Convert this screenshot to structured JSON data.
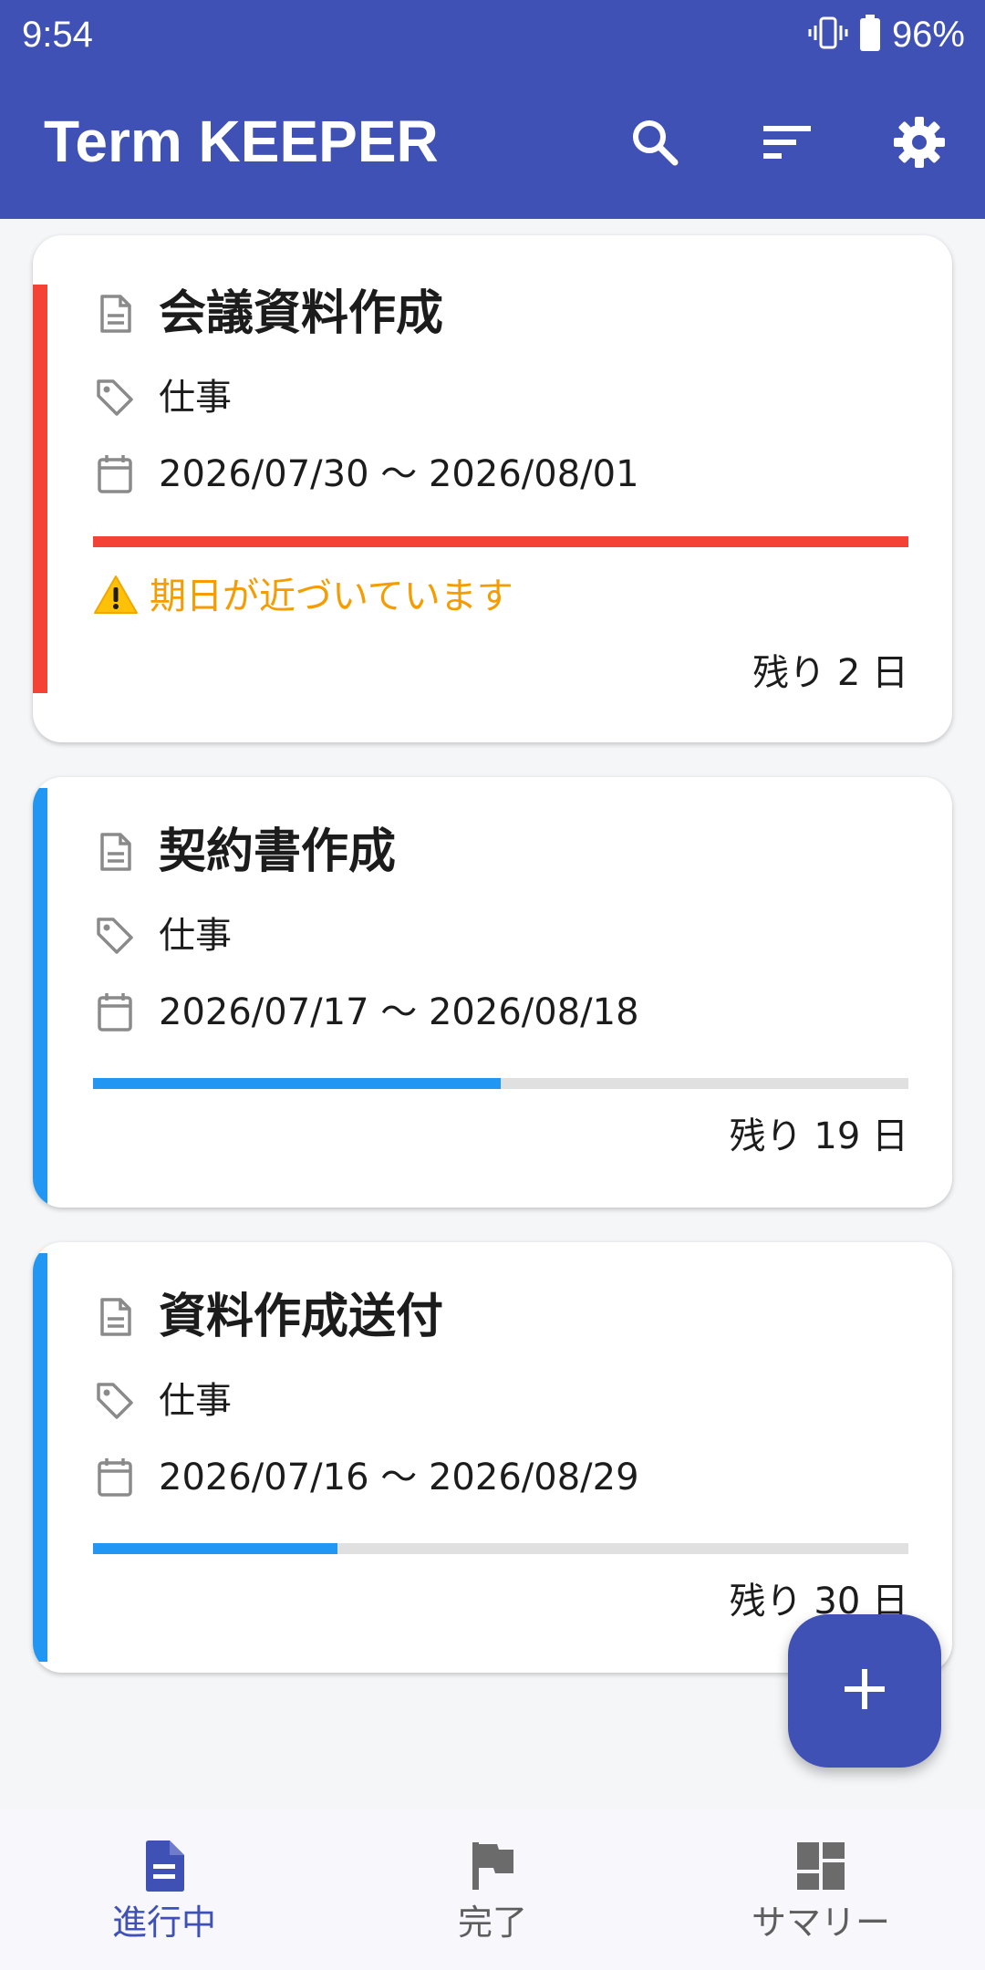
{
  "status_bar": {
    "time": "9:54",
    "battery": "96%"
  },
  "app_bar": {
    "title": "Term KEEPER",
    "actions": [
      "search-icon",
      "sort-icon",
      "settings-icon"
    ]
  },
  "tasks": [
    {
      "title": "会議資料作成",
      "category": "仕事",
      "period": "2026/07/30 〜 2026/08/01",
      "progress": 1.0,
      "warning": "期日が近づいています",
      "remaining": "残り 2 日",
      "accent_color": "#f44336"
    },
    {
      "title": "契約書作成",
      "category": "仕事",
      "period": "2026/07/17 〜 2026/08/18",
      "progress": 0.5,
      "remaining": "残り 19 日",
      "accent_color": "#2196f3"
    },
    {
      "title": "資料作成送付",
      "category": "仕事",
      "period": "2026/07/16 〜 2026/08/29",
      "progress": 0.3,
      "remaining": "残り 30 日",
      "accent_color": "#2196f3"
    }
  ],
  "fab": {
    "icon": "plus-icon"
  },
  "bottom_nav": [
    {
      "label": "進行中",
      "icon": "document-icon",
      "active": true
    },
    {
      "label": "完了",
      "icon": "flag-icon",
      "active": false
    },
    {
      "label": "サマリー",
      "icon": "dashboard-icon",
      "active": false
    }
  ],
  "colors": {
    "primary": "#3f51b5",
    "urgent": "#f44336",
    "normal": "#2196f3",
    "warning": "#f59c00"
  }
}
